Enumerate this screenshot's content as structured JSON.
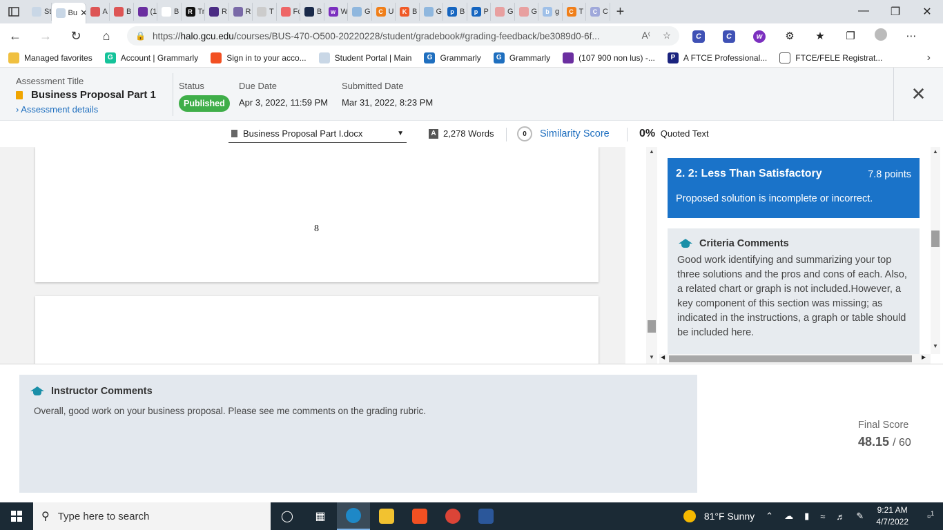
{
  "browser": {
    "tabs": [
      {
        "label": "St",
        "color": "#c9d7e6",
        "glyph": ""
      },
      {
        "label": "Bu",
        "color": "#c9d7e6",
        "glyph": "",
        "active": true
      },
      {
        "label": "A",
        "color": "#d55",
        "glyph": ""
      },
      {
        "label": "B",
        "color": "#d55",
        "glyph": ""
      },
      {
        "label": "(1",
        "color": "#6b2fa0",
        "glyph": ""
      },
      {
        "label": "B",
        "color": "#fff",
        "glyph": ""
      },
      {
        "label": "Tr",
        "color": "#111",
        "glyph": "R"
      },
      {
        "label": "R",
        "color": "#4b2c84",
        "glyph": ""
      },
      {
        "label": "R",
        "color": "#7a6aa8",
        "glyph": ""
      },
      {
        "label": "T",
        "color": "#ccc",
        "glyph": ""
      },
      {
        "label": "Fc",
        "color": "#e66",
        "glyph": ""
      },
      {
        "label": "B",
        "color": "#1a2a4a",
        "glyph": ""
      },
      {
        "label": "W",
        "color": "#7b2fbf",
        "glyph": "w"
      },
      {
        "label": "G",
        "color": "#8fb7de",
        "glyph": ""
      },
      {
        "label": "U",
        "color": "#f07f1a",
        "glyph": "C"
      },
      {
        "label": "B",
        "color": "#f05a28",
        "glyph": "K"
      },
      {
        "label": "G",
        "color": "#8fb7de",
        "glyph": ""
      },
      {
        "label": "B",
        "color": "#1565c0",
        "glyph": "p"
      },
      {
        "label": "P",
        "color": "#1565c0",
        "glyph": "p"
      },
      {
        "label": "G",
        "color": "#e8a0a0",
        "glyph": ""
      },
      {
        "label": "G",
        "color": "#e8a0a0",
        "glyph": ""
      },
      {
        "label": "g",
        "color": "#9fc0e8",
        "glyph": "b"
      },
      {
        "label": "T",
        "color": "#f07f1a",
        "glyph": "C"
      },
      {
        "label": "C",
        "color": "#9fa8da",
        "glyph": "C"
      }
    ],
    "url_prefix": "https://",
    "url_host": "halo.gcu.edu",
    "url_path": "/courses/BUS-470-O500-20220228/student/gradebook#grading-feedback/be3089d0-6f...",
    "favorites": [
      {
        "label": "Managed favorites",
        "color": "#f0c040",
        "glyph": ""
      },
      {
        "label": "Account | Grammarly",
        "color": "#15c39a",
        "glyph": "G"
      },
      {
        "label": "Sign in to your acco...",
        "color": "#f25022",
        "glyph": ""
      },
      {
        "label": "Student Portal | Main",
        "color": "#c9d7e6",
        "glyph": ""
      },
      {
        "label": "Grammarly",
        "color": "#1f6fbf",
        "glyph": "G"
      },
      {
        "label": "Grammarly",
        "color": "#1f6fbf",
        "glyph": "G"
      },
      {
        "label": "(107 900 non lus) -...",
        "color": "#6b2fa0",
        "glyph": ""
      },
      {
        "label": "A FTCE Professional...",
        "color": "#1a237e",
        "glyph": "P"
      },
      {
        "label": "FTCE/FELE Registrat...",
        "color": "#fff",
        "glyph": ""
      }
    ]
  },
  "assessment": {
    "title_label": "Assessment Title",
    "title": "Business Proposal Part 1",
    "details_link": "Assessment details",
    "status_label": "Status",
    "status": "Published",
    "due_label": "Due Date",
    "due": "Apr 3, 2022, 11:59 PM",
    "submitted_label": "Submitted Date",
    "submitted": "Mar 31, 2022, 8:23 PM"
  },
  "toolbar": {
    "document": "Business Proposal Part I.docx",
    "words": "2,278 Words",
    "similarity_value": "0",
    "similarity_label": "Similarity Score",
    "quoted_value": "0%",
    "quoted_label": "Quoted Text"
  },
  "document": {
    "page_number": "8"
  },
  "rubric": {
    "level_title": "2. 2: Less Than Satisfactory",
    "points": "7.8 points",
    "description": "Proposed solution is incomplete or incorrect.",
    "comments_title": "Criteria Comments",
    "comments": "Good work identifying and summarizing your top three solutions and the pros and cons of each. Also, a related chart or graph is not included.However, a key component of this section was missing; as indicated in the instructions, a graph or table should be included here."
  },
  "instructor": {
    "title": "Instructor Comments",
    "comment": "Overall, good work on your business proposal. Please see me comments on the grading rubric."
  },
  "score": {
    "label": "Final Score",
    "value": "48.15",
    "total": "/ 60"
  },
  "taskbar": {
    "search_placeholder": "Type here to search",
    "weather": "81°F  Sunny",
    "time": "9:21 AM",
    "date": "4/7/2022",
    "notifications": "1"
  },
  "colors": {
    "accent": "#1a73c9",
    "published": "#3fae49",
    "link": "#1f6fbf"
  }
}
